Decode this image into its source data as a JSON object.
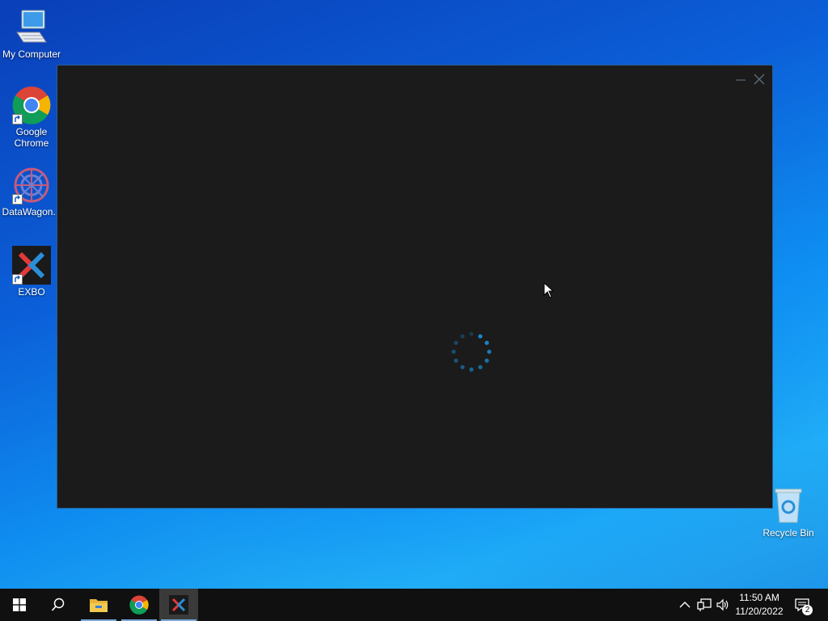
{
  "desktop": {
    "icons": [
      {
        "label": "My Computer",
        "icon": "computer-icon"
      },
      {
        "label": "Google\nChrome",
        "icon": "chrome-icon"
      },
      {
        "label": "DataWagon...",
        "icon": "datawagon-icon"
      },
      {
        "label": "EXBO",
        "icon": "exbo-icon"
      },
      {
        "label": "Recycle Bin",
        "icon": "recycle-bin-icon"
      }
    ]
  },
  "app_window": {
    "state": "loading",
    "minimize_icon": "minimize-icon",
    "close_icon": "close-icon",
    "spinner_color": "#1a8fd8"
  },
  "taskbar": {
    "start_icon": "windows-start-icon",
    "search_icon": "search-icon",
    "pinned": [
      "file-explorer-icon",
      "chrome-icon",
      "exbo-icon"
    ],
    "clock": {
      "time": "11:50 AM",
      "date": "11/20/2022"
    },
    "notification_count": "2"
  },
  "colors": {
    "window_bg": "#1b1b1b",
    "window_border": "#2b5e92",
    "taskbar_bg": "#101010"
  }
}
